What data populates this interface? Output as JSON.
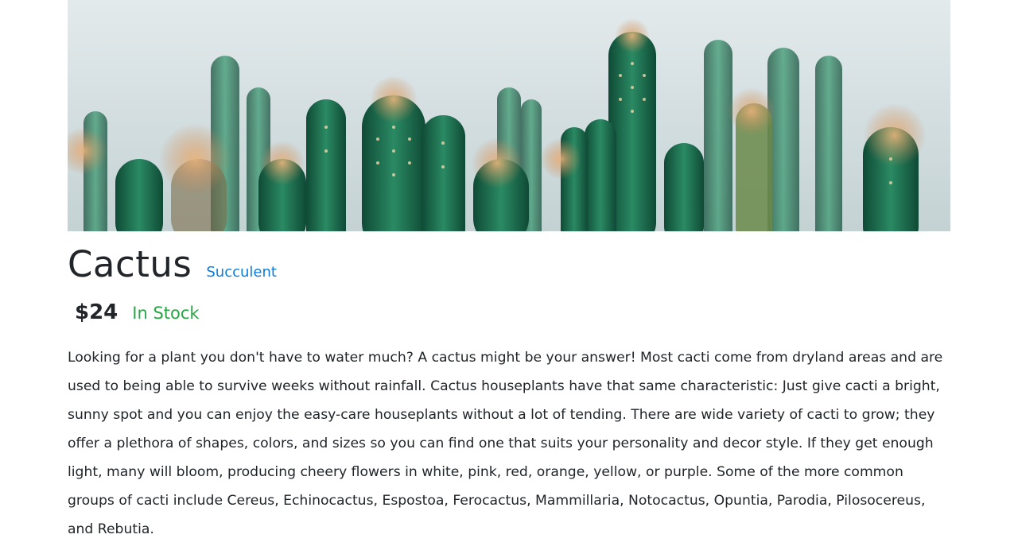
{
  "product": {
    "name": "Cactus",
    "category": "Succulent",
    "price": "$24",
    "stock_status": "In Stock",
    "description": "Looking for a plant you don't have to water much? A cactus might be your answer! Most cacti come from dryland areas and are used to being able to survive weeks without rainfall. Cactus houseplants have that same characteristic: Just give cacti a bright, sunny spot and you can enjoy the easy-care houseplants without a lot of tending. There are wide variety of cacti to grow; they offer a plethora of shapes, colors, and sizes so you can find one that suits your personality and decor style. If they get enough light, many will bloom, producing cheery flowers in white, pink, red, orange, yellow, or purple. Some of the more common groups of cacti include Cereus, Echinocactus, Espostoa, Ferocactus, Mammillaria, Notocactus, Opuntia, Parodia, Pilosocereus, and Rebutia."
  },
  "colors": {
    "link": "#0a7ce0",
    "in_stock": "#28a745",
    "text": "#212529",
    "cactus_green": "#1f6b4f"
  }
}
